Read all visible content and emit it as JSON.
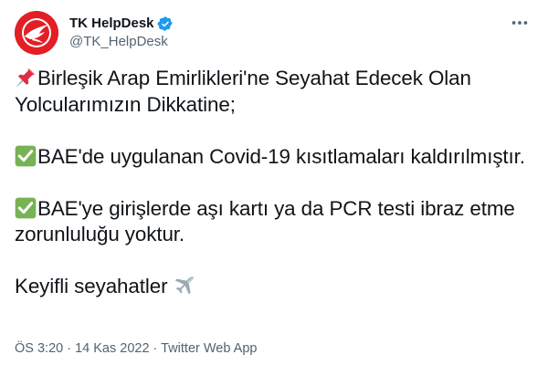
{
  "account": {
    "display_name": "TK HelpDesk",
    "handle": "@TK_HelpDesk",
    "avatar_icon": "turkish-airlines-logo-icon",
    "verified_icon": "verified-badge-icon",
    "brand_color": "#e31e24",
    "verified_color": "#1d9bf0"
  },
  "menu": {
    "icon": "more-horizontal-icon"
  },
  "tweet": {
    "lines": [
      {
        "emoji": "pushpin-icon",
        "text": "Birleşik Arap Emirlikleri'ne Seyahat Edecek Olan Yolcularımızın Dikkatine;"
      },
      {
        "emoji": "check-mark-icon",
        "text": "BAE'de uygulanan Covid-19 kısıtlamaları kaldırılmıştır."
      },
      {
        "emoji": "check-mark-icon",
        "text": "BAE'ye girişlerde aşı kartı ya da PCR testi ibraz etme zorunluluğu yoktur."
      },
      {
        "emoji": "airplane-icon",
        "text": "Keyifli seyahatler"
      }
    ]
  },
  "meta": {
    "time": "ÖS 3:20",
    "separator": " · ",
    "date": "14 Kas 2022",
    "source": "Twitter Web App"
  }
}
